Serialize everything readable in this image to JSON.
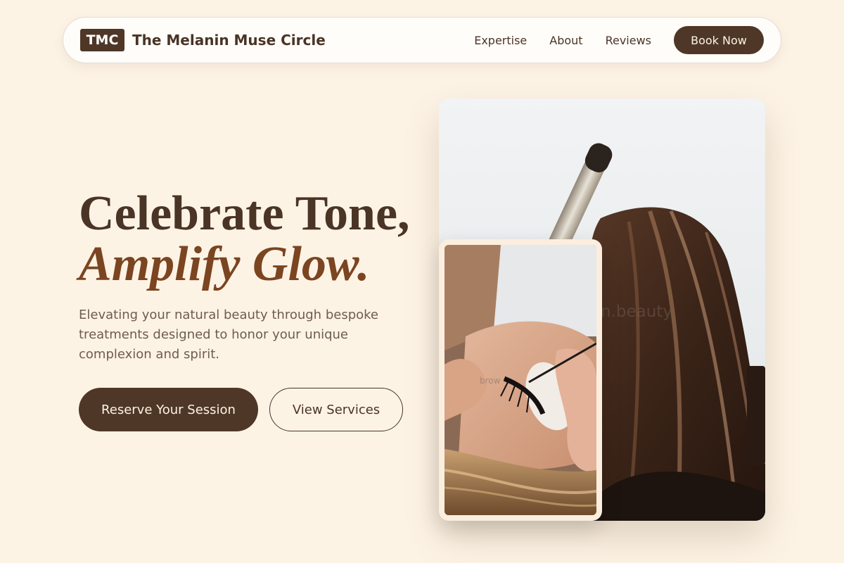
{
  "nav": {
    "logo": "TMC",
    "brand": "The Melanin Muse Circle",
    "links": [
      "Expertise",
      "About",
      "Reviews"
    ],
    "cta": "Book Now"
  },
  "hero": {
    "line1": "Celebrate Tone,",
    "line2": "Amplify Glow.",
    "subtitle": "Elevating your natural beauty through bespoke treatments designed to honor your unique complexion and spirit.",
    "primary_button": "Reserve Your Session",
    "secondary_button": "View Services"
  },
  "images": {
    "main_watermark": "n.beauty",
    "inset_watermark": "brow"
  },
  "colors": {
    "background": "#fdf3e5",
    "brand_dark": "#4e3727",
    "accent": "#7a4520"
  }
}
